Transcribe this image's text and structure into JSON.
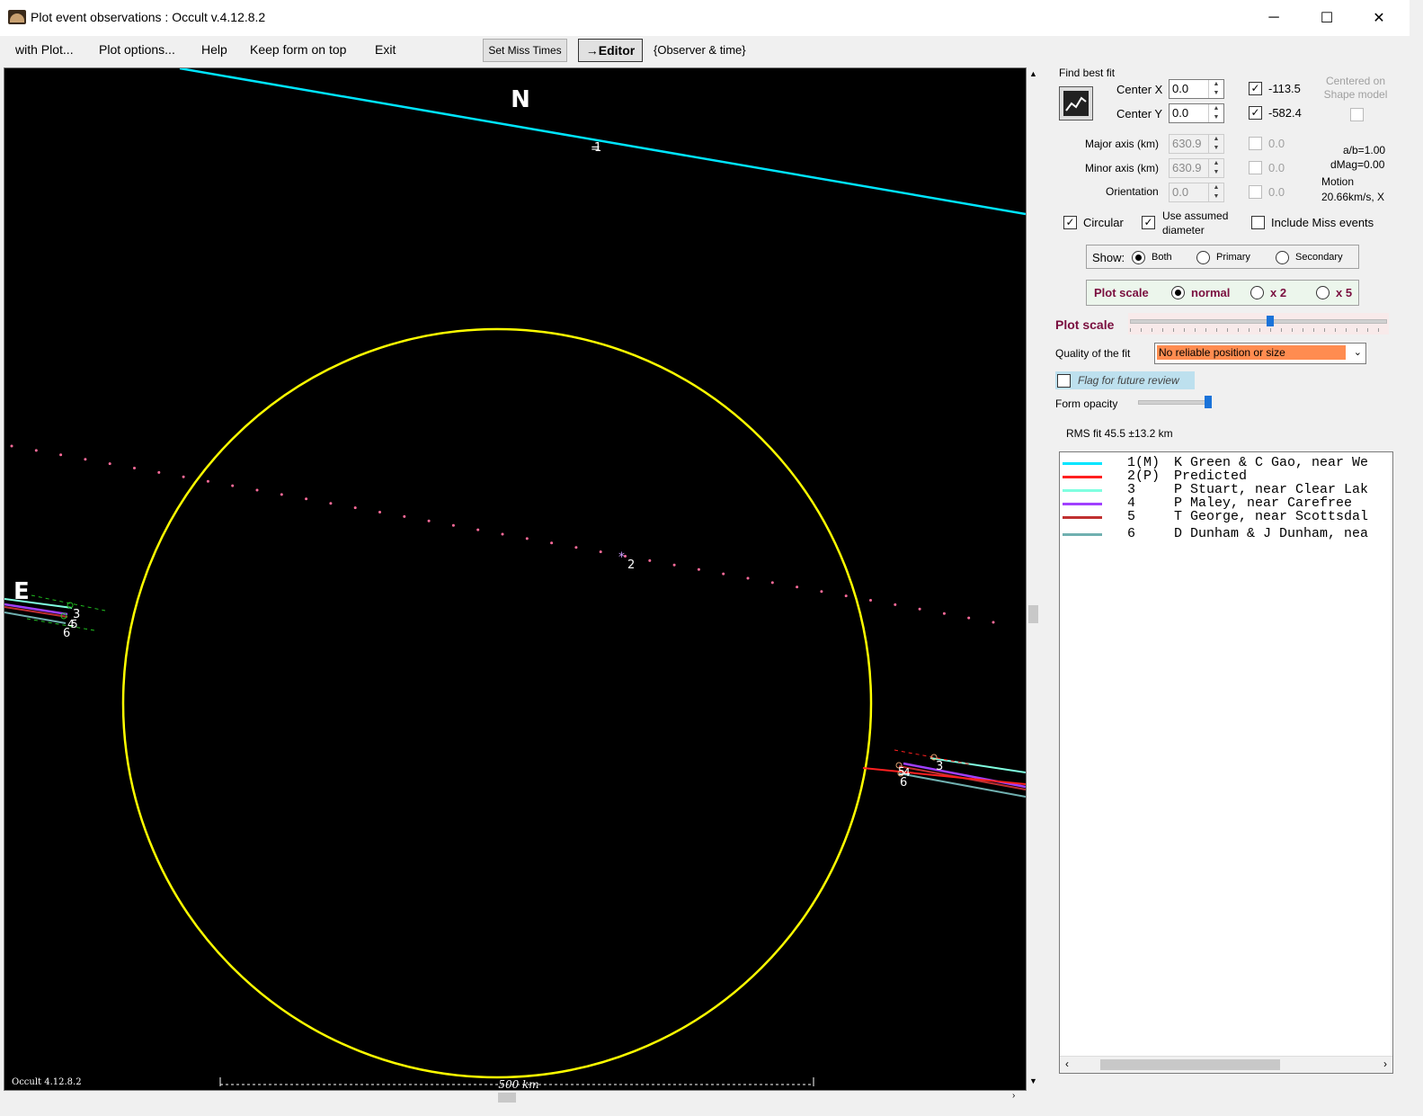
{
  "window": {
    "title": "Plot event observations : Occult v.4.12.8.2"
  },
  "menu": {
    "items": [
      "with Plot...",
      "Plot options...",
      "Help",
      "Keep form on top",
      "Exit"
    ],
    "set_miss_times": "Set Miss Times",
    "editor": "→Editor",
    "observer_time": "{Observer & time}"
  },
  "plot": {
    "north_label": "N",
    "east_label": "E",
    "version_label": "Occult 4.12.8.2",
    "scale_bar_label": "500 km",
    "chord_labels": [
      "1",
      "2",
      "3",
      "4",
      "5",
      "6"
    ],
    "colors": {
      "background": "#000000",
      "ellipse": "#ffff00",
      "path1": "#00e5ff",
      "path2": "#ff3030",
      "path3": "#80ffe0",
      "path4": "#a040ff",
      "path5": "#c03030",
      "path6": "#70b0b0",
      "predicted_dots": "#ff6b9a"
    }
  },
  "panel": {
    "find_best_fit": "Find best fit",
    "center_x_label": "Center X",
    "center_x_value": "0.0",
    "center_x_check": "-113.5",
    "center_y_label": "Center Y",
    "center_y_value": "0.0",
    "center_y_check": "-582.4",
    "centered_on_shape": "Centered on Shape model",
    "major_axis_label": "Major axis (km)",
    "major_axis_value": "630.9",
    "major_axis_check": "0.0",
    "minor_axis_label": "Minor axis (km)",
    "minor_axis_value": "630.9",
    "minor_axis_check": "0.0",
    "orientation_label": "Orientation",
    "orientation_value": "0.0",
    "orientation_check": "0.0",
    "ab_ratio": "a/b=1.00",
    "dmag": "dMag=0.00",
    "motion_label": "Motion",
    "motion_value": "20.66km/s, X",
    "circular": "Circular",
    "use_assumed_diameter": "Use assumed diameter",
    "include_miss_events": "Include Miss events",
    "show_label": "Show:",
    "show_options": [
      "Both",
      "Primary",
      "Secondary"
    ],
    "plot_scale_label": "Plot scale",
    "plot_scale_options": [
      "normal",
      "x 2",
      "x 5"
    ],
    "plot_scale_slider_label": "Plot scale",
    "plot_scale_slider": 0.55,
    "quality_label": "Quality of the fit",
    "quality_value": "No reliable position or size",
    "flag_review": "Flag for future review",
    "form_opacity_label": "Form opacity",
    "form_opacity": 1.0,
    "rms_fit": "RMS fit 45.5 ±13.2 km"
  },
  "legend": [
    {
      "id": "1(M)",
      "text": "K Green & C Gao, near We",
      "color": "#00e5ff"
    },
    {
      "id": "2(P)",
      "text": "Predicted",
      "color": "#ff2020"
    },
    {
      "id": "3",
      "text": "P Stuart, near Clear Lak",
      "color": "#80ffe0"
    },
    {
      "id": "4",
      "text": "P Maley, near Carefree",
      "color": "#a040ff"
    },
    {
      "id": "5",
      "text": "T George, near Scottsdal",
      "color": "#c03030"
    },
    {
      "id": "6",
      "text": "D Dunham & J Dunham, nea",
      "color": "#70b0b0"
    }
  ]
}
